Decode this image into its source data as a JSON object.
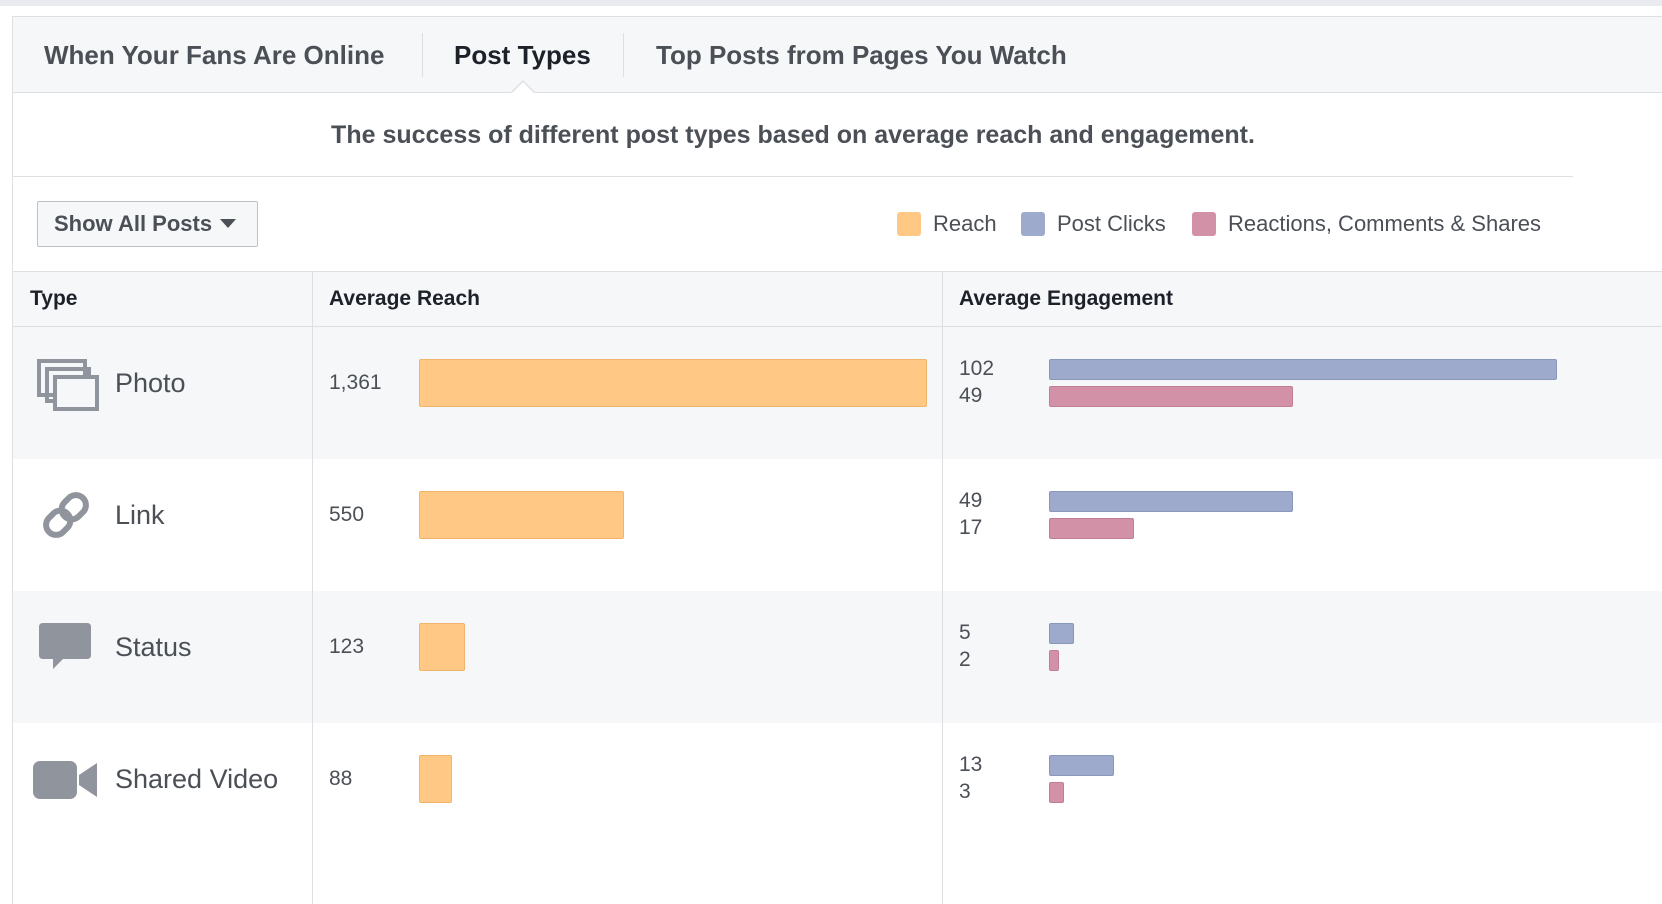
{
  "tabs": [
    {
      "label": "When Your Fans Are Online",
      "active": false
    },
    {
      "label": "Post Types",
      "active": true
    },
    {
      "label": "Top Posts from Pages You Watch",
      "active": false
    }
  ],
  "subtitle": "The success of different post types based on average reach and engagement.",
  "filter": {
    "label": "Show All Posts",
    "icon": "caret-down-icon"
  },
  "legend": [
    {
      "label": "Reach",
      "color": "#ffc884"
    },
    {
      "label": "Post Clicks",
      "color": "#9daacb"
    },
    {
      "label": "Reactions, Comments & Shares",
      "color": "#d291a7"
    }
  ],
  "table": {
    "headers": {
      "type": "Type",
      "reach": "Average Reach",
      "engagement": "Average Engagement"
    },
    "rows": [
      {
        "type": "Photo",
        "icon": "photo-icon",
        "reach": "1,361",
        "clicks": "102",
        "rcs": "49"
      },
      {
        "type": "Link",
        "icon": "link-icon",
        "reach": "550",
        "clicks": "49",
        "rcs": "17"
      },
      {
        "type": "Status",
        "icon": "status-icon",
        "reach": "123",
        "clicks": "5",
        "rcs": "2"
      },
      {
        "type": "Shared Video",
        "icon": "video-icon",
        "reach": "88",
        "clicks": "13",
        "rcs": "3"
      }
    ]
  },
  "chart_data": {
    "type": "bar",
    "categories": [
      "Photo",
      "Link",
      "Status",
      "Shared Video"
    ],
    "series": [
      {
        "name": "Reach",
        "values": [
          1361,
          550,
          123,
          88
        ]
      },
      {
        "name": "Post Clicks",
        "values": [
          102,
          49,
          5,
          13
        ]
      },
      {
        "name": "Reactions, Comments & Shares",
        "values": [
          49,
          17,
          2,
          3
        ]
      }
    ]
  }
}
